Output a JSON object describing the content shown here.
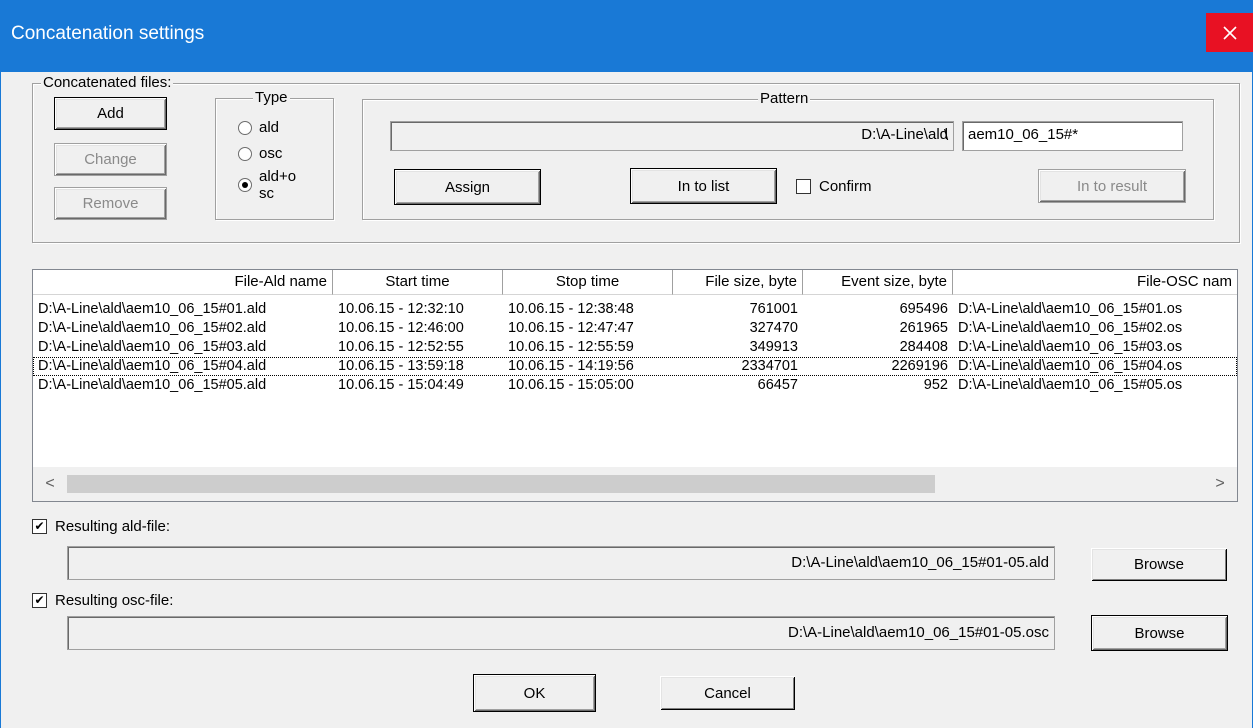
{
  "window": {
    "title": "Concatenation settings",
    "close_glyph": "✕"
  },
  "concatenated": {
    "legend": "Concatenated files:",
    "add_label": "Add",
    "change_label": "Change",
    "remove_label": "Remove"
  },
  "type_group": {
    "legend": "Type",
    "options": [
      "ald",
      "osc",
      "ald+osc"
    ],
    "selected": "ald+osc",
    "option3_line1": "ald+o",
    "option3_line2": "sc"
  },
  "pattern": {
    "legend": "Pattern",
    "path_value": "D:\\A-Line\\ald",
    "separator": "\\",
    "mask_value": "aem10_06_15#*",
    "assign_label": "Assign",
    "in_to_list_label": "In to list",
    "confirm_label": "Confirm",
    "confirm_checked": false,
    "in_to_result_label": "In to result"
  },
  "table": {
    "columns": [
      "File-Ald name",
      "Start time",
      "Stop time",
      "File size, byte",
      "Event size, byte",
      "File-OSC nam"
    ],
    "rows": [
      [
        "D:\\A-Line\\ald\\aem10_06_15#01.ald",
        "10.06.15  -  12:32:10",
        "10.06.15  -  12:38:48",
        "761001",
        "695496",
        "D:\\A-Line\\ald\\aem10_06_15#01.os"
      ],
      [
        "D:\\A-Line\\ald\\aem10_06_15#02.ald",
        "10.06.15  -  12:46:00",
        "10.06.15  -  12:47:47",
        "327470",
        "261965",
        "D:\\A-Line\\ald\\aem10_06_15#02.os"
      ],
      [
        "D:\\A-Line\\ald\\aem10_06_15#03.ald",
        "10.06.15  -  12:52:55",
        "10.06.15  -  12:55:59",
        "349913",
        "284408",
        "D:\\A-Line\\ald\\aem10_06_15#03.os"
      ],
      [
        "D:\\A-Line\\ald\\aem10_06_15#04.ald",
        "10.06.15  -  13:59:18",
        "10.06.15  -  14:19:56",
        "2334701",
        "2269196",
        "D:\\A-Line\\ald\\aem10_06_15#04.os"
      ],
      [
        "D:\\A-Line\\ald\\aem10_06_15#05.ald",
        "10.06.15  -  15:04:49",
        "10.06.15  -  15:05:00",
        "66457",
        "952",
        "D:\\A-Line\\ald\\aem10_06_15#05.os"
      ]
    ],
    "scroll_left": "<",
    "scroll_right": ">"
  },
  "result_ald": {
    "label": "Resulting ald-file:",
    "checked": true,
    "check_glyph": "✔",
    "path": "D:\\A-Line\\ald\\aem10_06_15#01-05.ald",
    "browse_label": "Browse"
  },
  "result_osc": {
    "label": "Resulting osc-file:",
    "checked": true,
    "check_glyph": "✔",
    "path": "D:\\A-Line\\ald\\aem10_06_15#01-05.osc",
    "browse_label": "Browse"
  },
  "footer": {
    "ok_label": "OK",
    "cancel_label": "Cancel"
  },
  "colors": {
    "titlebar": "#1979d6",
    "close": "#e81123",
    "dialog": "#f0f0f0"
  }
}
